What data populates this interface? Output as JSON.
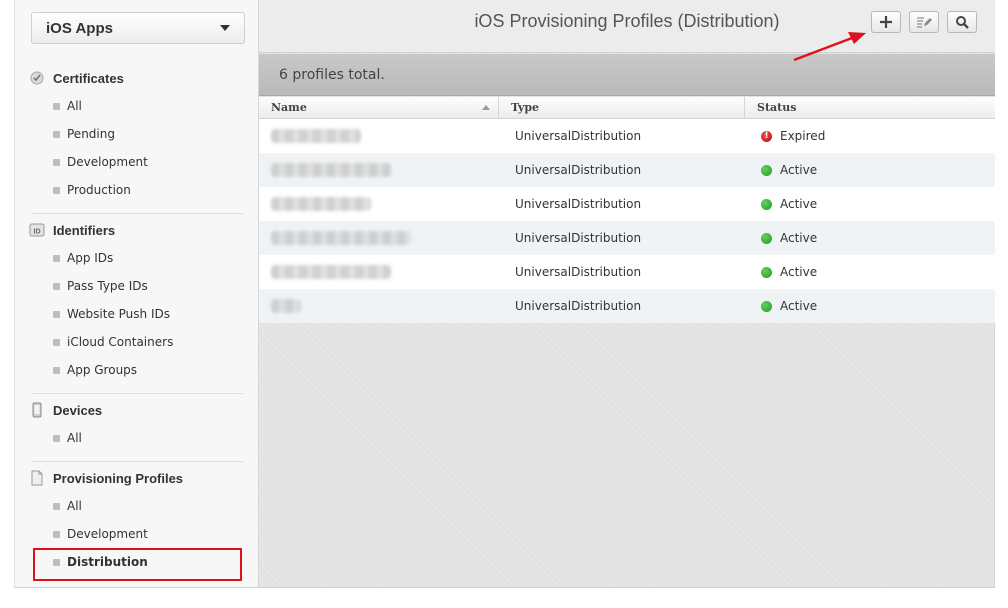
{
  "sidebar": {
    "platform_select": "iOS Apps",
    "sections": [
      {
        "title": "Certificates",
        "icon": "certificate-icon",
        "items": [
          "All",
          "Pending",
          "Development",
          "Production"
        ]
      },
      {
        "title": "Identifiers",
        "icon": "id-icon",
        "icon_text": "ID",
        "items": [
          "App IDs",
          "Pass Type IDs",
          "Website Push IDs",
          "iCloud Containers",
          "App Groups"
        ]
      },
      {
        "title": "Devices",
        "icon": "device-icon",
        "items": [
          "All"
        ]
      },
      {
        "title": "Provisioning Profiles",
        "icon": "document-icon",
        "items": [
          "All",
          "Development",
          "Distribution"
        ]
      }
    ],
    "active_item": "Distribution"
  },
  "main": {
    "title": "iOS Provisioning Profiles (Distribution)",
    "toolbar": {
      "add_icon": "plus-icon",
      "edit_icon": "edit-icon",
      "search_icon": "search-icon"
    },
    "summary": "6 profiles total.",
    "table": {
      "columns": [
        "Name",
        "Type",
        "Status"
      ],
      "rows": [
        {
          "type": "UniversalDistribution",
          "status": "Expired"
        },
        {
          "type": "UniversalDistribution",
          "status": "Active"
        },
        {
          "type": "UniversalDistribution",
          "status": "Active"
        },
        {
          "type": "UniversalDistribution",
          "status": "Active"
        },
        {
          "type": "UniversalDistribution",
          "status": "Active"
        },
        {
          "type": "UniversalDistribution",
          "status": "Active"
        }
      ]
    }
  },
  "colors": {
    "annotation_red": "#e0101e",
    "status_active": "#2bab2b",
    "status_expired": "#d01616"
  }
}
